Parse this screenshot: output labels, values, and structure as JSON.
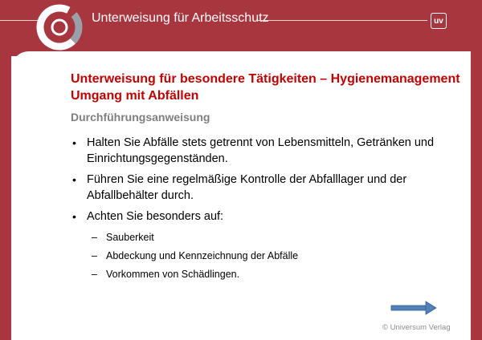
{
  "header": {
    "title": "Unterweisung für Arbeitsschutz",
    "badge": "uv"
  },
  "slide": {
    "title_line1": "Unterweisung für besondere Tätigkeiten – Hygienemanagement",
    "title_line2": "Umgang mit Abfällen",
    "subtitle": "Durchführungsanweisung",
    "bullet_marker": "•",
    "sub_marker": "–",
    "bullets": [
      "Halten Sie Abfälle stets getrennt von Lebensmitteln, Getränken und Einrichtungsgegenständen.",
      "Führen Sie eine regelmäßige Kontrolle der Abfalllager und der Abfallbehälter durch.",
      "Achten Sie besonders auf:"
    ],
    "sub_bullets": [
      "Sauberkeit",
      "Abdeckung und Kennzeichnung der Abfälle",
      "Vorkommen von Schädlingen."
    ]
  },
  "footer": {
    "copyright": "© Universum Verlag",
    "next_icon": "right-arrow-icon"
  },
  "colors": {
    "brand_red": "#a8363f",
    "title_red": "#c00000",
    "subtitle_gray": "#7f7f7f",
    "arrow_blue": "#4f81bd"
  }
}
